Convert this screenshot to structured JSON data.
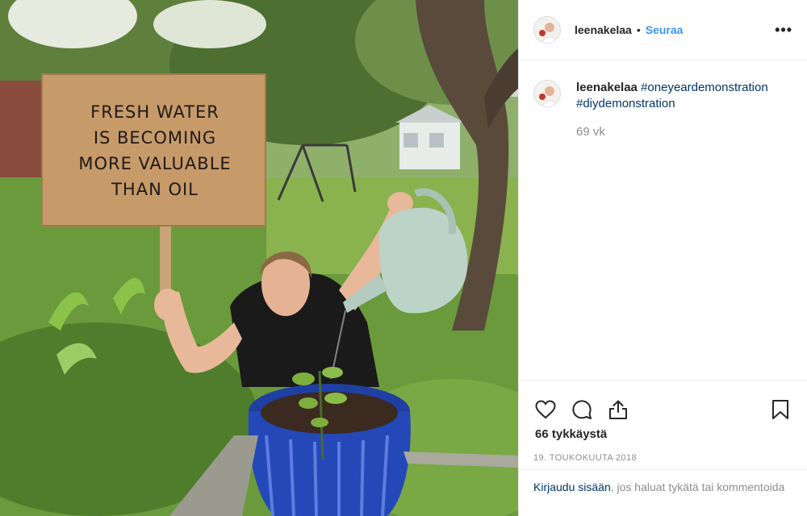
{
  "post": {
    "sign": {
      "lines": [
        "FRESH WATER",
        "IS BECOMING",
        "MORE VALUABLE",
        "THAN OIL"
      ]
    }
  },
  "header": {
    "username": "leenakelaa",
    "separator": "•",
    "follow_label": "Seuraa",
    "more_label": "•••"
  },
  "caption": {
    "username": "leenakelaa",
    "hashtags": [
      "#oneyeardemonstration",
      "#diydemonstration"
    ],
    "time_ago": "69 vk"
  },
  "actions": {
    "icons": [
      "heart-icon",
      "comment-icon",
      "share-icon",
      "bookmark-icon"
    ],
    "likes": "66 tykkäystä",
    "date": "19. TOUKOKUUTA 2018"
  },
  "login_prompt": {
    "link": "Kirjaudu sisään",
    "text": ", jos haluat tykätä tai kommentoida"
  },
  "colors": {
    "follow": "#3897f0",
    "hashtag": "#003569",
    "muted": "#8e8e8e",
    "divider": "#efefef"
  }
}
